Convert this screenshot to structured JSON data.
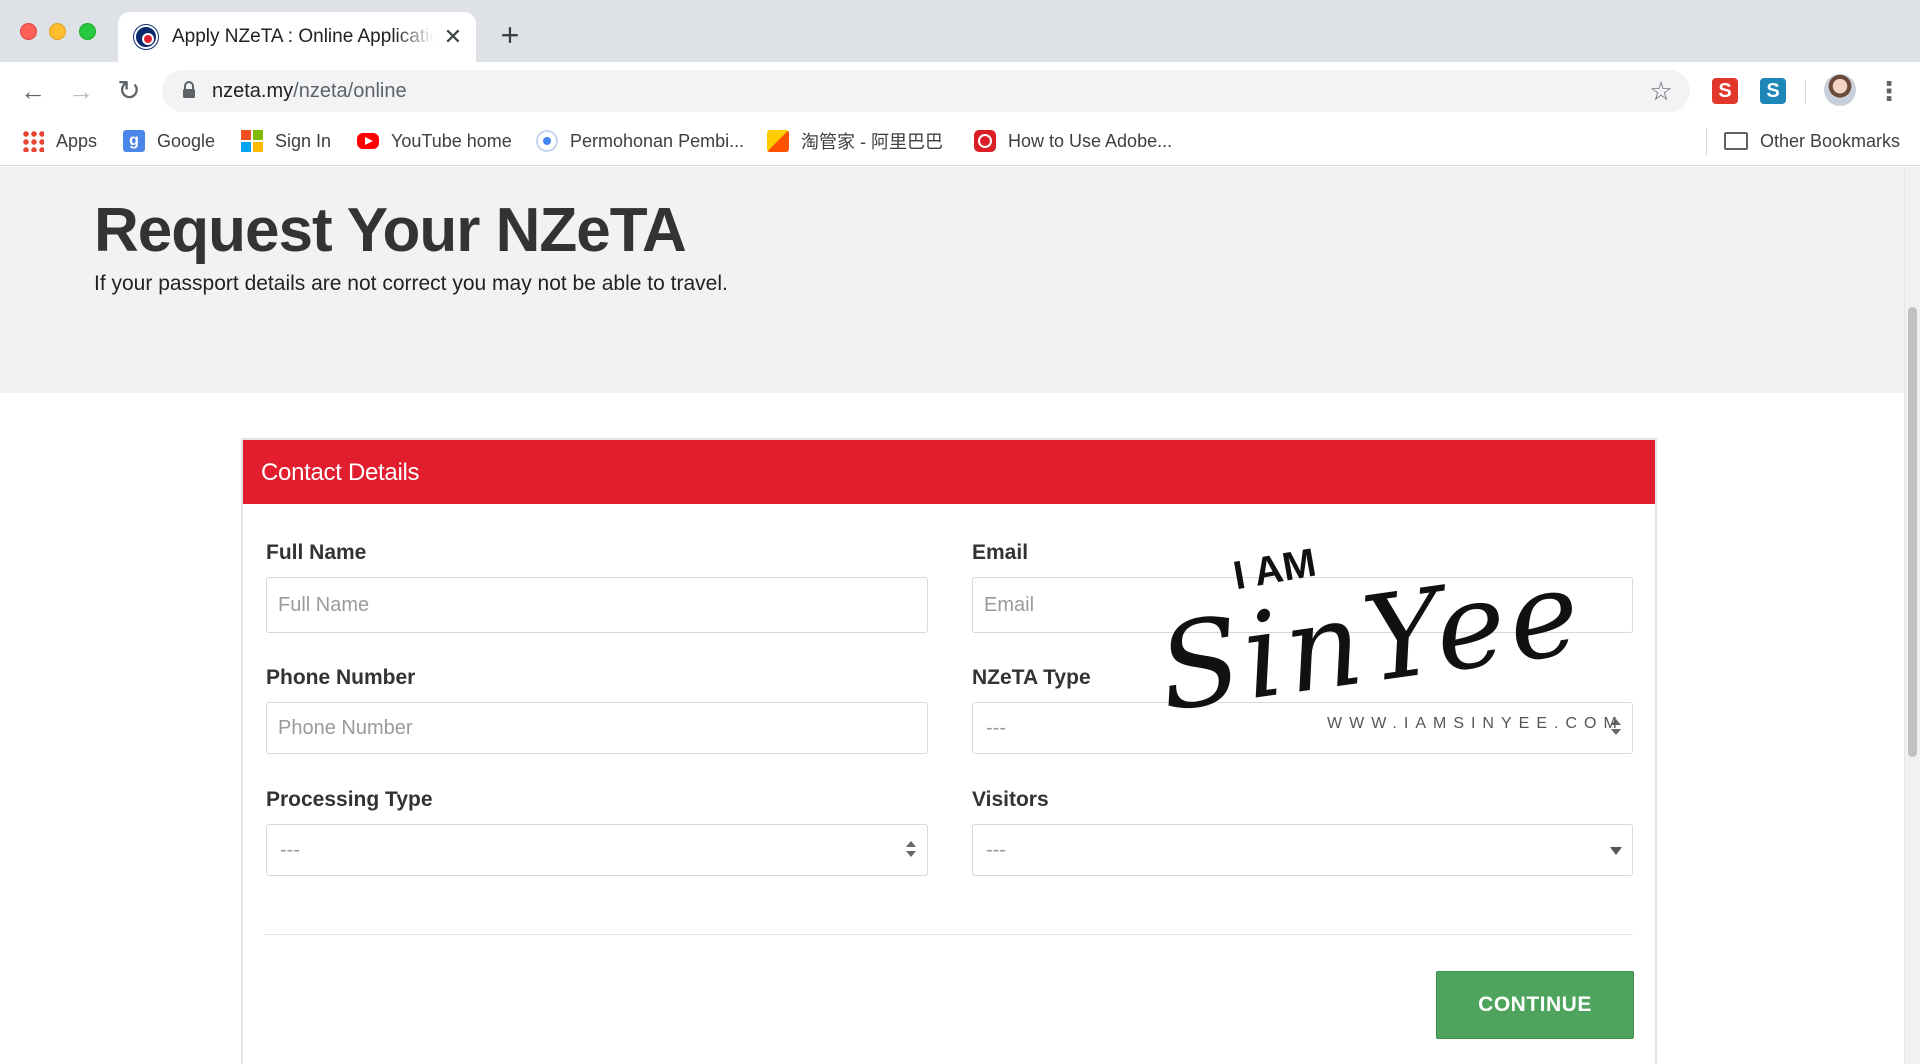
{
  "browser": {
    "tab_title": "Apply NZeTA : Online Application",
    "tab_close": "✕",
    "new_tab": "+",
    "url_domain": "nzeta.my",
    "url_path": "/nzeta/online",
    "nav_back": "←",
    "nav_forward": "→",
    "nav_reload": "↻",
    "star": "☆",
    "menu": "⋮",
    "extensions": [
      "S",
      "S"
    ],
    "bookmarks": [
      {
        "label": "Apps",
        "icon": "apps-icon"
      },
      {
        "label": "Google",
        "icon": "google-icon",
        "glyph": "g"
      },
      {
        "label": "Sign In",
        "icon": "microsoft-icon"
      },
      {
        "label": "YouTube home",
        "icon": "youtube-icon"
      },
      {
        "label": "Permohonan Pembi...",
        "icon": "chrome-icon"
      },
      {
        "label": "淘管家 - 阿里巴巴",
        "icon": "taobao-icon"
      },
      {
        "label": "How to Use Adobe...",
        "icon": "adobe-icon"
      }
    ],
    "other_bookmarks": "Other Bookmarks"
  },
  "hero": {
    "title": "Request Your NZeTA",
    "subtitle": "If your passport details are not correct you may not be able to travel."
  },
  "form": {
    "section_title": "Contact Details",
    "full_name": {
      "label": "Full Name",
      "placeholder": "Full Name"
    },
    "email": {
      "label": "Email",
      "placeholder": "Email"
    },
    "phone": {
      "label": "Phone Number",
      "placeholder": "Phone Number"
    },
    "nzeta_type": {
      "label": "NZeTA Type",
      "value": "---"
    },
    "processing_type": {
      "label": "Processing Type",
      "value": "---"
    },
    "visitors": {
      "label": "Visitors",
      "value": "---"
    },
    "continue_label": "CONTINUE"
  },
  "watermark": {
    "top": "I AM",
    "script": "SinYee",
    "url": "WWW.IAMSINYEE.COM"
  },
  "colors": {
    "header_red": "#e11d2e",
    "continue_green": "#4ea35d",
    "hero_bg": "#f2f2f2"
  }
}
